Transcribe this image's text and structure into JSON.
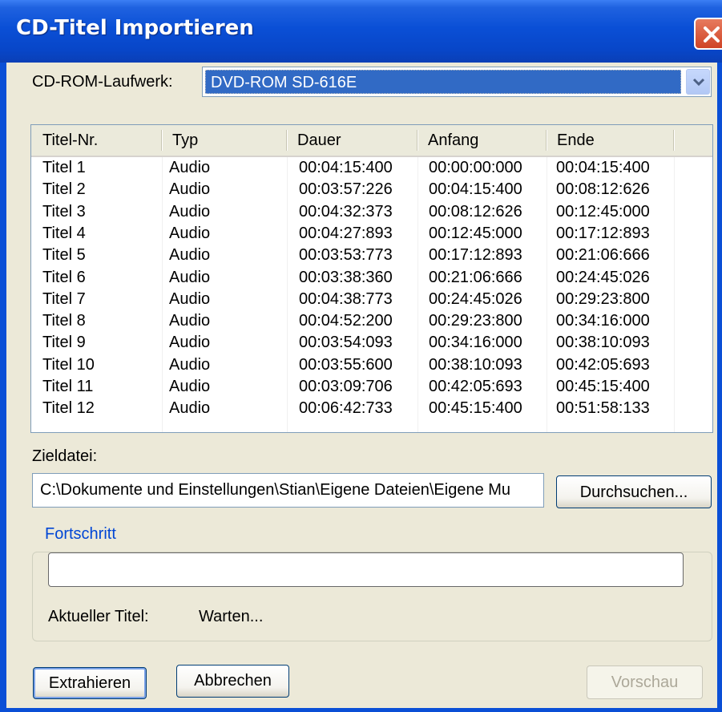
{
  "window": {
    "title": "CD-Titel Importieren"
  },
  "drive": {
    "label": "CD-ROM-Laufwerk:",
    "selected": "DVD-ROM SD-616E"
  },
  "tracks": {
    "columns": [
      "Titel-Nr.",
      "Typ",
      "Dauer",
      "Anfang",
      "Ende"
    ],
    "rows": [
      [
        "Titel 1",
        "Audio",
        "00:04:15:400",
        "00:00:00:000",
        "00:04:15:400"
      ],
      [
        "Titel 2",
        "Audio",
        "00:03:57:226",
        "00:04:15:400",
        "00:08:12:626"
      ],
      [
        "Titel 3",
        "Audio",
        "00:04:32:373",
        "00:08:12:626",
        "00:12:45:000"
      ],
      [
        "Titel 4",
        "Audio",
        "00:04:27:893",
        "00:12:45:000",
        "00:17:12:893"
      ],
      [
        "Titel 5",
        "Audio",
        "00:03:53:773",
        "00:17:12:893",
        "00:21:06:666"
      ],
      [
        "Titel 6",
        "Audio",
        "00:03:38:360",
        "00:21:06:666",
        "00:24:45:026"
      ],
      [
        "Titel 7",
        "Audio",
        "00:04:38:773",
        "00:24:45:026",
        "00:29:23:800"
      ],
      [
        "Titel 8",
        "Audio",
        "00:04:52:200",
        "00:29:23:800",
        "00:34:16:000"
      ],
      [
        "Titel 9",
        "Audio",
        "00:03:54:093",
        "00:34:16:000",
        "00:38:10:093"
      ],
      [
        "Titel 10",
        "Audio",
        "00:03:55:600",
        "00:38:10:093",
        "00:42:05:693"
      ],
      [
        "Titel 11",
        "Audio",
        "00:03:09:706",
        "00:42:05:693",
        "00:45:15:400"
      ],
      [
        "Titel 12",
        "Audio",
        "00:06:42:733",
        "00:45:15:400",
        "00:51:58:133"
      ]
    ]
  },
  "target": {
    "label": "Zieldatei:",
    "path": "C:\\Dokumente und Einstellungen\\Stian\\Eigene Dateien\\Eigene Mu",
    "browse_label": "Durchsuchen..."
  },
  "progress": {
    "group_title": "Fortschritt",
    "value": 0,
    "current_label": "Aktueller Titel:",
    "current_value": "Warten..."
  },
  "buttons": {
    "extract": "Extrahieren",
    "cancel": "Abbrechen",
    "preview": "Vorschau"
  },
  "colors": {
    "titlebar": "#0a4fd6",
    "dialog_bg": "#ece9d8",
    "selection": "#316ac5",
    "group_title": "#0046d5",
    "close_button": "#cf4426"
  },
  "icons": {
    "close": "close-icon",
    "dropdown": "chevron-down-icon"
  }
}
